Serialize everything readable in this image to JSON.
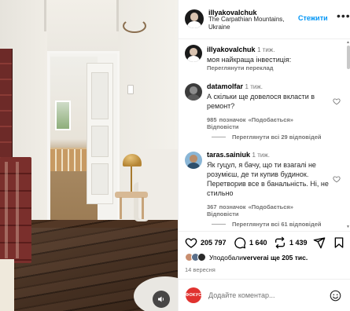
{
  "header": {
    "username": "illyakovalchuk",
    "location": "The Carpathian Mountains, Ukraine",
    "follow_label": "Стежити",
    "more_label": "•••"
  },
  "caption": {
    "username": "illyakovalchuk",
    "time": "1 тиж.",
    "text": "моя найкраща інвестиція:",
    "translate_label": "Переглянути переклад"
  },
  "comments": [
    {
      "username": "datamolfar",
      "time": "1 тиж.",
      "text": "А скільки ще довелося вкласти в ремонт?",
      "likes": "985 позначок «Подобається»",
      "reply_label": "Відповісти",
      "replies": "Переглянути всі 29 відповідей"
    },
    {
      "username": "taras.sainiuk",
      "time": "1 тиж.",
      "text": "Як гуцул, я бачу, що ти взагалі не розумієш, де ти купив будинок. Перетворив все в банальність. Ні, не стильно",
      "likes": "367 позначок «Подобається»",
      "reply_label": "Відповісти",
      "replies": "Переглянути всі 61 відповідей"
    }
  ],
  "actions": {
    "likes_count": "205 797",
    "comments_count": "1 640",
    "reposts_count": "1 439",
    "liked_by_prefix": "Уподобали ",
    "liked_by_user": "ververa",
    "liked_by_suffix": " і ще 205 тис.",
    "date": "14 вересня"
  },
  "comment_box": {
    "avatar_label": "ФОКУС",
    "placeholder": "Додайте коментар..."
  },
  "colors": {
    "accent": "#0095f6",
    "secondary_text": "#737373",
    "focus_brand": "#e0322f"
  }
}
